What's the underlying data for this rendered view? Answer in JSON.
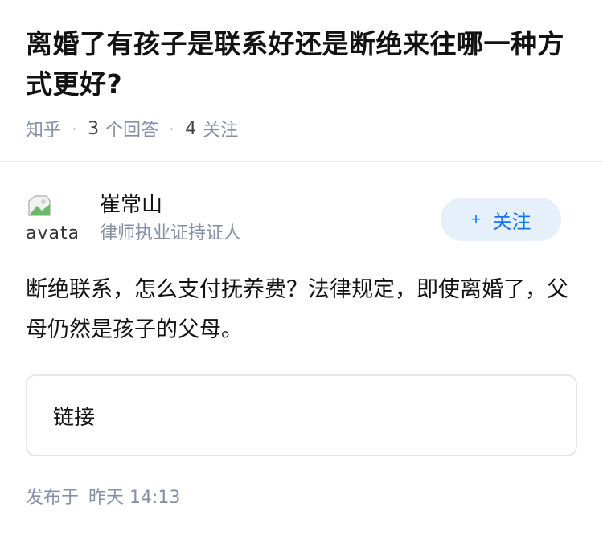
{
  "question": {
    "title": "离婚了有孩子是联系好还是断绝来往哪一种方式更好?",
    "source": "知乎",
    "answer_count": "3",
    "answer_label": "个回答",
    "follow_count": "4",
    "follow_label": "关注"
  },
  "author": {
    "avatar_alt": "avatar",
    "name": "崔常山",
    "badge": "律师执业证持证人",
    "follow_button": "关注",
    "follow_icon": "plus-icon"
  },
  "answer": {
    "text": "断绝联系，怎么支付抚养费？法律规定，即使离婚了，父母仍然是孩子的父母。",
    "link_label": "链接"
  },
  "publish": {
    "prefix": "发布于",
    "time": "昨天 14:13"
  },
  "colors": {
    "accent": "#1772f6",
    "follow_bg": "#e5f0fb",
    "meta_gray": "#8590a6"
  }
}
